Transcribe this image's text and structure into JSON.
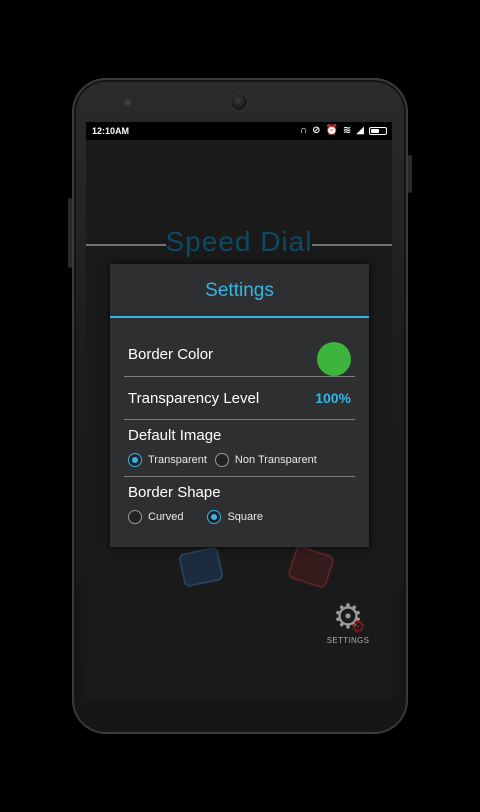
{
  "status_bar": {
    "time": "12:10AM",
    "icons": [
      "headset-icon",
      "mute-icon",
      "alarm-icon",
      "wifi-icon",
      "signal-icon",
      "battery-icon"
    ]
  },
  "background": {
    "title": "Speed Dial",
    "settings_label": "SETTINGS"
  },
  "dialog": {
    "title": "Settings",
    "border_color": {
      "label": "Border Color",
      "color": "#3db53d"
    },
    "transparency": {
      "label": "Transparency Level",
      "value": "100%"
    },
    "default_image": {
      "label": "Default Image",
      "options": [
        {
          "label": "Transparent",
          "selected": true
        },
        {
          "label": "Non Transparent",
          "selected": false
        }
      ]
    },
    "border_shape": {
      "label": "Border Shape",
      "options": [
        {
          "label": "Curved",
          "selected": false
        },
        {
          "label": "Square",
          "selected": true
        }
      ]
    }
  },
  "colors": {
    "accent": "#33b5e5",
    "dialog_bg": "#2e2f30",
    "screen_bg": "#1a1a1b"
  }
}
